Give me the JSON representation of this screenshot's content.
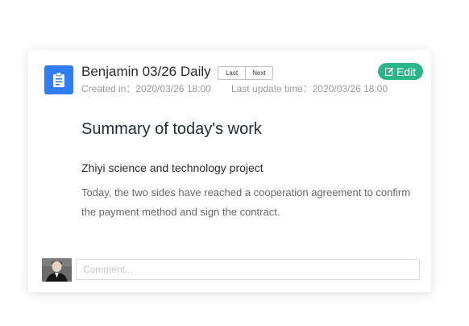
{
  "report": {
    "title": "Benjamin 03/26 Daily",
    "nav": {
      "last_label": "Last",
      "next_label": "Next"
    },
    "created": "Created in：2020/03/26 18:00",
    "updated": "Last update time：2020/03/26 18:00",
    "edit_label": "Edit",
    "icon": "clipboard-icon"
  },
  "content": {
    "heading": "Summary of today's work",
    "project": "Zhiyi science and technology project",
    "body": "Today, the two sides have reached a cooperation agreement to confirm the payment method and sign the contract."
  },
  "comment": {
    "placeholder": "Comment..."
  },
  "colors": {
    "accent_blue": "#2f7cf6",
    "edit_green": "#2ab58b"
  }
}
